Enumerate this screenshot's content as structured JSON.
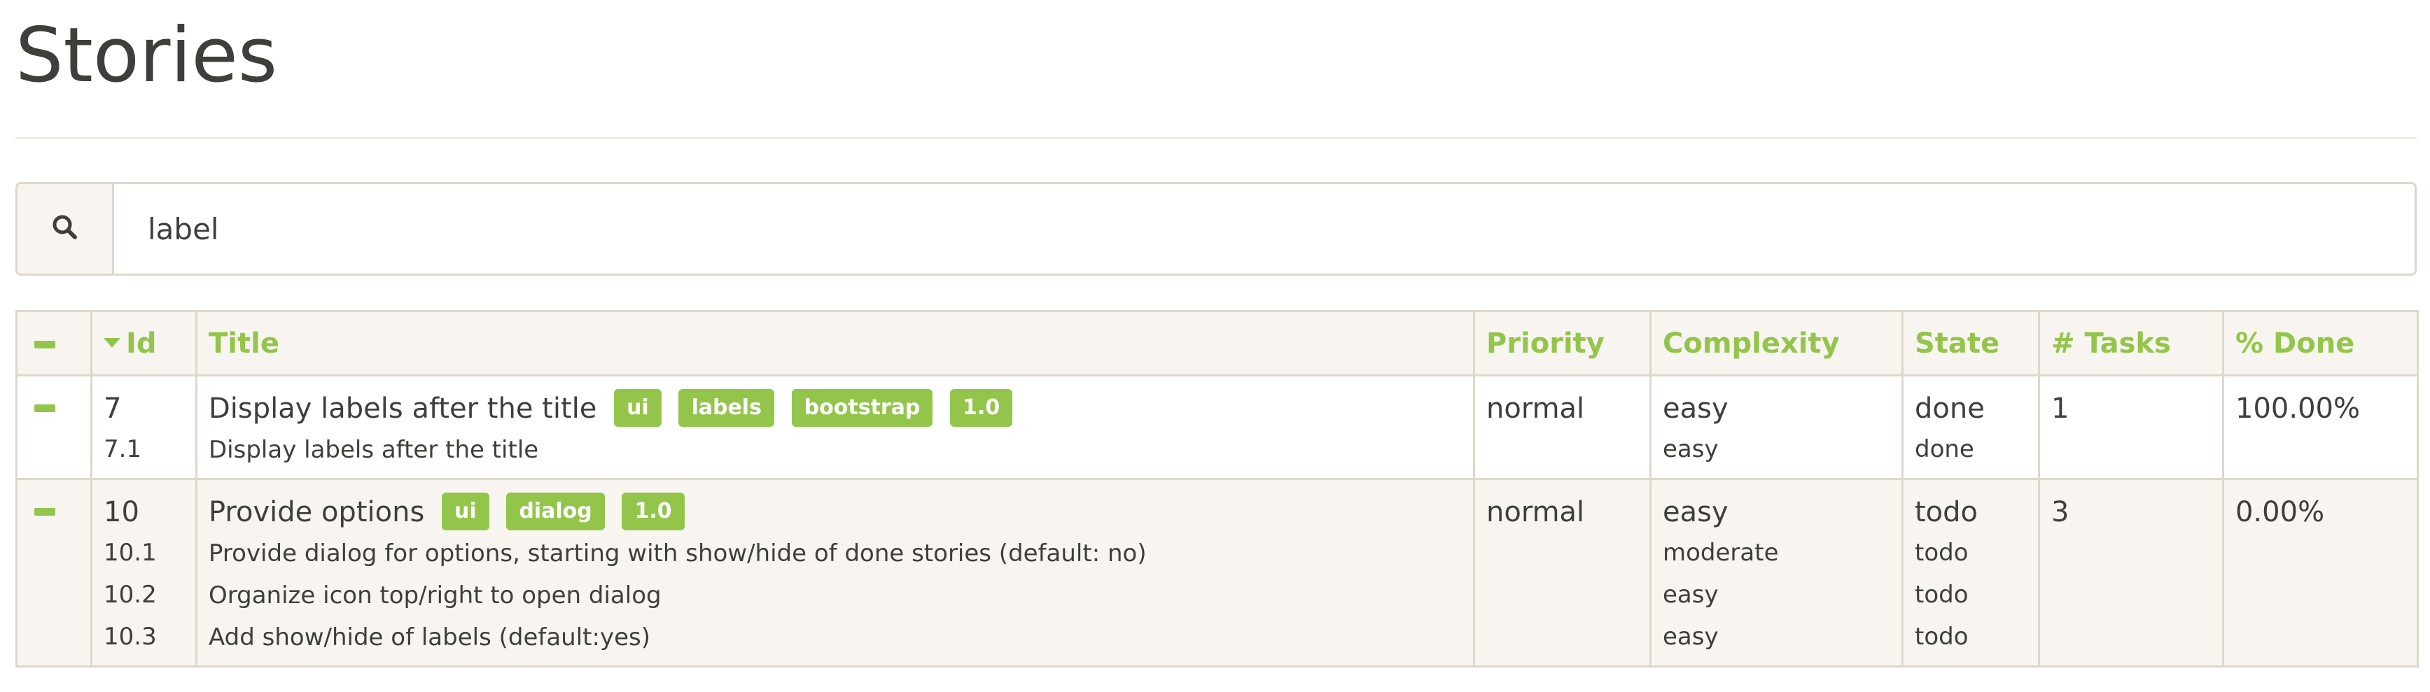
{
  "page": {
    "title": "Stories"
  },
  "search": {
    "icon": "search-icon",
    "value": "label"
  },
  "table": {
    "headers": {
      "toggle_icon": "minus-icon",
      "id": "Id",
      "id_sort_icon": "caret-down-icon",
      "title": "Title",
      "priority": "Priority",
      "complexity": "Complexity",
      "state": "State",
      "tasks": "# Tasks",
      "done": "% Done"
    },
    "stories": [
      {
        "id": "7",
        "title": "Display labels after the title",
        "labels": [
          "ui",
          "labels",
          "bootstrap",
          "1.0"
        ],
        "priority": "normal",
        "complexity": "easy",
        "state": "done",
        "tasks": "1",
        "done": "100.00%",
        "subtasks": [
          {
            "id": "7.1",
            "title": "Display labels after the title",
            "complexity": "easy",
            "state": "done"
          }
        ]
      },
      {
        "id": "10",
        "title": "Provide options",
        "labels": [
          "ui",
          "dialog",
          "1.0"
        ],
        "priority": "normal",
        "complexity": "easy",
        "state": "todo",
        "tasks": "3",
        "done": "0.00%",
        "subtasks": [
          {
            "id": "10.1",
            "title": "Provide dialog for options, starting with show/hide of done stories (default: no)",
            "complexity": "moderate",
            "state": "todo"
          },
          {
            "id": "10.2",
            "title": "Organize icon top/right to open dialog",
            "complexity": "easy",
            "state": "todo"
          },
          {
            "id": "10.3",
            "title": "Add show/hide of labels (default:yes)",
            "complexity": "easy",
            "state": "todo"
          }
        ]
      }
    ]
  },
  "colors": {
    "accent": "#93c54b",
    "border": "#dfd7ca",
    "header_bg": "#f8f5f0",
    "text": "#3e3f3a"
  }
}
